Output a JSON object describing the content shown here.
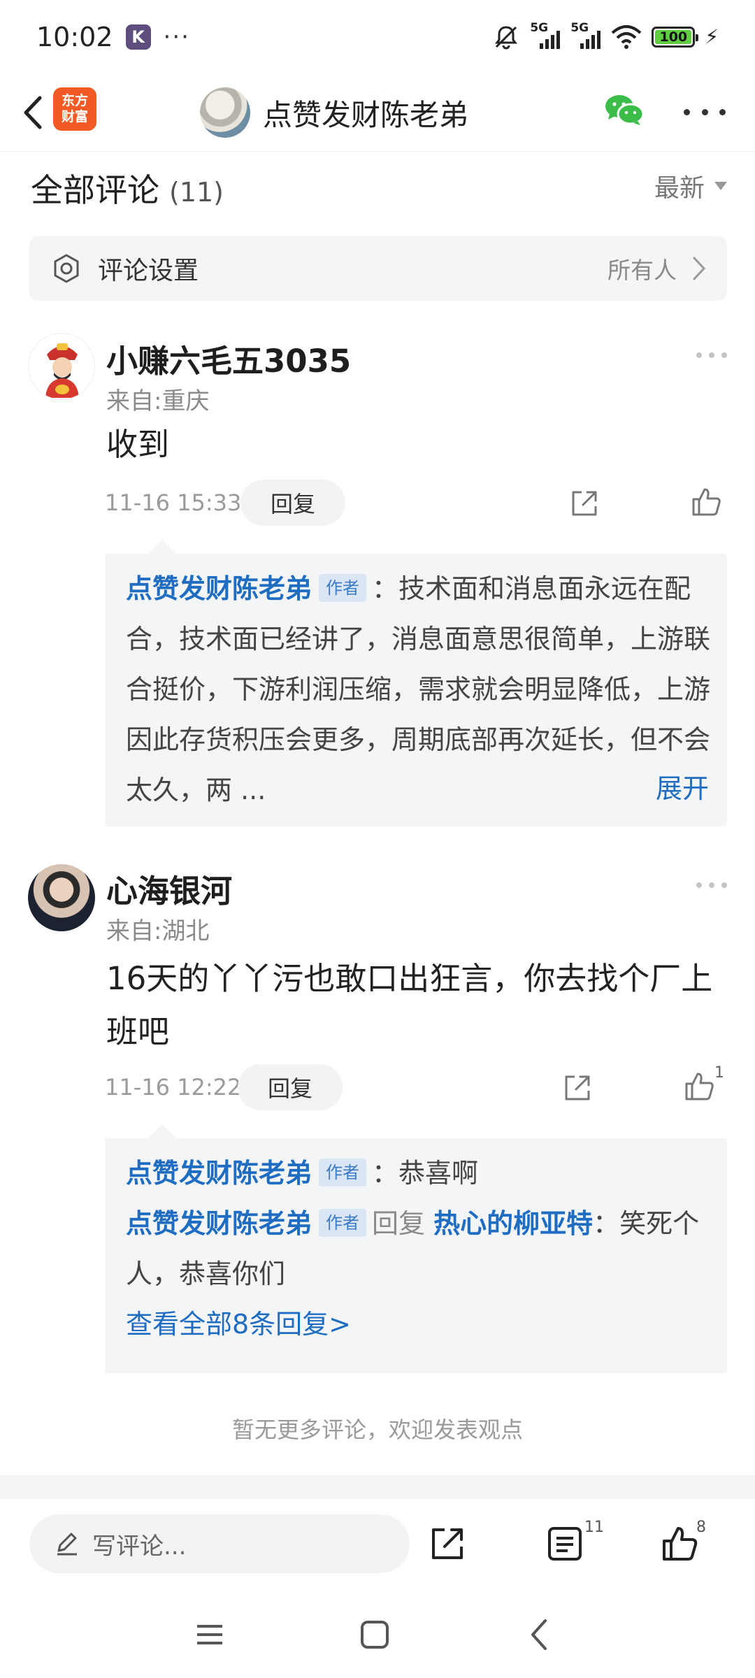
{
  "status_bar": {
    "time": "10:02",
    "app_badge": "K",
    "more_dots": "···",
    "network_1": "5G",
    "network_2": "5G",
    "battery": "100"
  },
  "nav": {
    "logo_line1": "东方",
    "logo_line2": "财富",
    "title": "点赞发财陈老弟"
  },
  "header": {
    "title": "全部评论",
    "count": "(11)",
    "sort_label": "最新"
  },
  "settings": {
    "label": "评论设置",
    "value": "所有人"
  },
  "comments": [
    {
      "name": "小赚六毛五3035",
      "location": "来自:重庆",
      "text": "收到",
      "time": "11-16 15:33",
      "reply_label": "回复",
      "like_count": "",
      "replies": [
        {
          "author": "点赞发财陈老弟",
          "tag": "作者",
          "text": "：技术面和消息面永远在配合，技术面已经讲了，消息面意思很简单，上游联合挺价，下游利润压缩，需求就会明显降低，上游因此存货积压会更多，周期底部再次延长，但不会太久，两 ...",
          "expand": "展开"
        }
      ]
    },
    {
      "name": "心海银河",
      "location": "来自:湖北",
      "text": "16天的丫丫污也敢口出狂言，你去找个厂上班吧",
      "time": "11-16 12:22",
      "reply_label": "回复",
      "like_count": "1",
      "replies": [
        {
          "author": "点赞发财陈老弟",
          "tag": "作者",
          "text": "：恭喜啊"
        },
        {
          "author": "点赞发财陈老弟",
          "tag": "作者",
          "reply_word": "回复",
          "target": "热心的柳亚特",
          "text": "：笑死个人，恭喜你们"
        }
      ],
      "view_all": "查看全部8条回复>"
    }
  ],
  "footer_note": "暂无更多评论，欢迎发表观点",
  "bottom_bar": {
    "input_placeholder": "写评论...",
    "comment_count": "11",
    "like_count": "8"
  },
  "colors": {
    "link_blue": "#1f6dc2",
    "brand_orange": "#f15a24",
    "battery_green": "#5fce41"
  },
  "icons": [
    "back-icon",
    "wechat-icon",
    "more-icon",
    "gear-icon",
    "chevron-right-icon",
    "share-icon",
    "thumbs-up-icon",
    "pencil-icon",
    "list-icon"
  ]
}
